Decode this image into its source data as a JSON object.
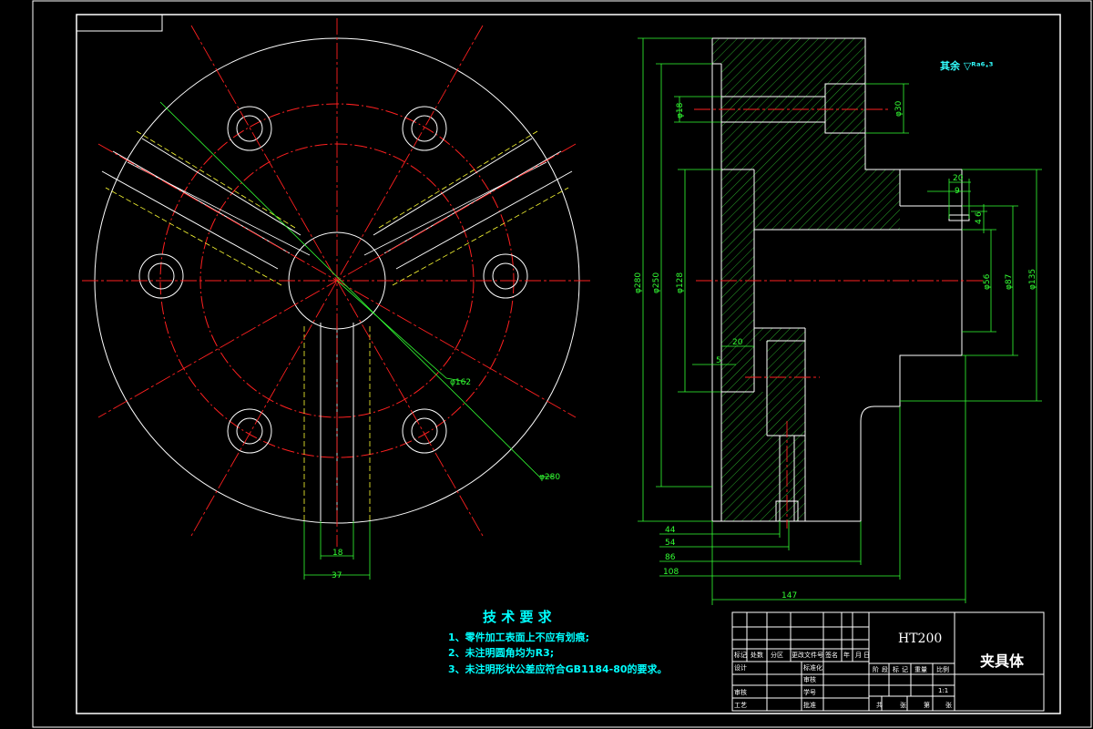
{
  "surface_note": "其余 ▽ᴿᵃ⁶·³",
  "technical_requirements": {
    "title": "技 术 要 求",
    "items": [
      "1、零件加工表面上不应有划痕;",
      "2、未注明圆角均为R3;",
      "3、未注明形状公差应符合GB1184-80的要求。"
    ]
  },
  "front_view_dims": {
    "pcd": "φ162",
    "outer_circle": "φ280",
    "slot_width": "18",
    "slot_overall": "37"
  },
  "section_view_dims": {
    "d280": "φ280",
    "d250": "φ250",
    "d128": "φ128",
    "d18": "φ18",
    "d30": "φ30",
    "d56": "φ56",
    "d87": "φ87",
    "d135": "φ135",
    "dim20_left": "20",
    "dim5": "5",
    "top20": "20",
    "top9": "9",
    "side4": "4",
    "side6": "6",
    "len44": "44",
    "len54": "54",
    "len86": "86",
    "len108": "108",
    "len147": "147"
  },
  "title_block": {
    "material": "HT200",
    "part_name": "夹具体",
    "row_labels": [
      "标记",
      "处数",
      "分区",
      "更改文件号",
      "签名",
      "年",
      "月",
      "日"
    ],
    "design": "设计",
    "standardize": "标准化",
    "review": "审核",
    "process": "工艺",
    "approve": "批准",
    "stage_labels": [
      "阶",
      "段",
      "标",
      "记",
      "重量",
      "比例"
    ],
    "scale": "1:1",
    "sheets": [
      "共",
      "张",
      "第",
      "张"
    ],
    "checked": "审核",
    "learn": "学号",
    "approve2": "批准"
  }
}
